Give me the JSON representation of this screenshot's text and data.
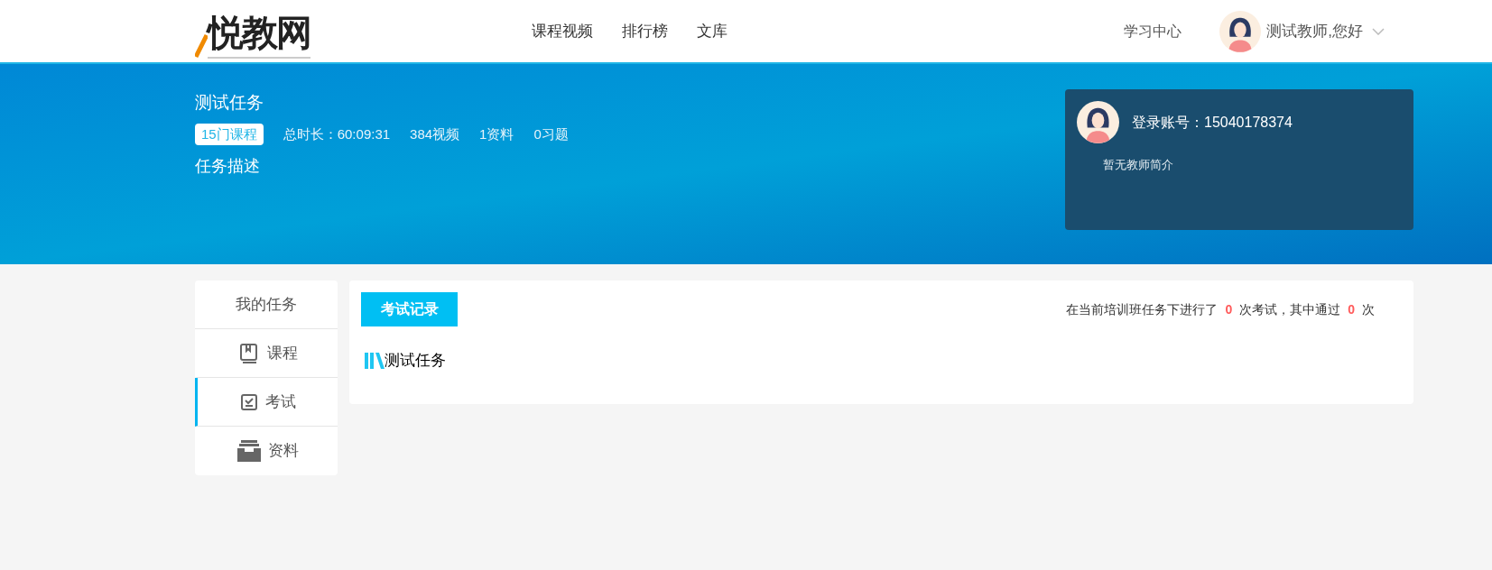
{
  "header": {
    "logo": "悦教网",
    "nav": [
      {
        "label": "课程视频"
      },
      {
        "label": "排行榜"
      },
      {
        "label": "文库"
      }
    ],
    "study_center": "学习中心",
    "user_greeting": "测试教师,您好"
  },
  "banner": {
    "title": "测试任务",
    "course_badge": "15门课程",
    "stats": [
      "总时长：60:09:31",
      "384视频",
      "1资料",
      "0习题"
    ],
    "description_label": "任务描述",
    "teacher_card": {
      "account": "登录账号：15040178374",
      "intro": "暂无教师简介"
    }
  },
  "sidebar": {
    "title": "我的任务",
    "items": [
      {
        "label": "课程",
        "selected": false
      },
      {
        "label": "考试",
        "selected": true
      },
      {
        "label": "资料",
        "selected": false
      }
    ]
  },
  "content": {
    "tab": "考试记录",
    "summary": [
      {
        "kind": "text",
        "text": "在当前培训班任务下进行了"
      },
      {
        "kind": "count",
        "text": "0"
      },
      {
        "kind": "text",
        "text": "次考试，其中通过"
      },
      {
        "kind": "count",
        "text": "0"
      },
      {
        "kind": "text",
        "text": "次"
      }
    ],
    "task_title": "测试任务"
  }
}
